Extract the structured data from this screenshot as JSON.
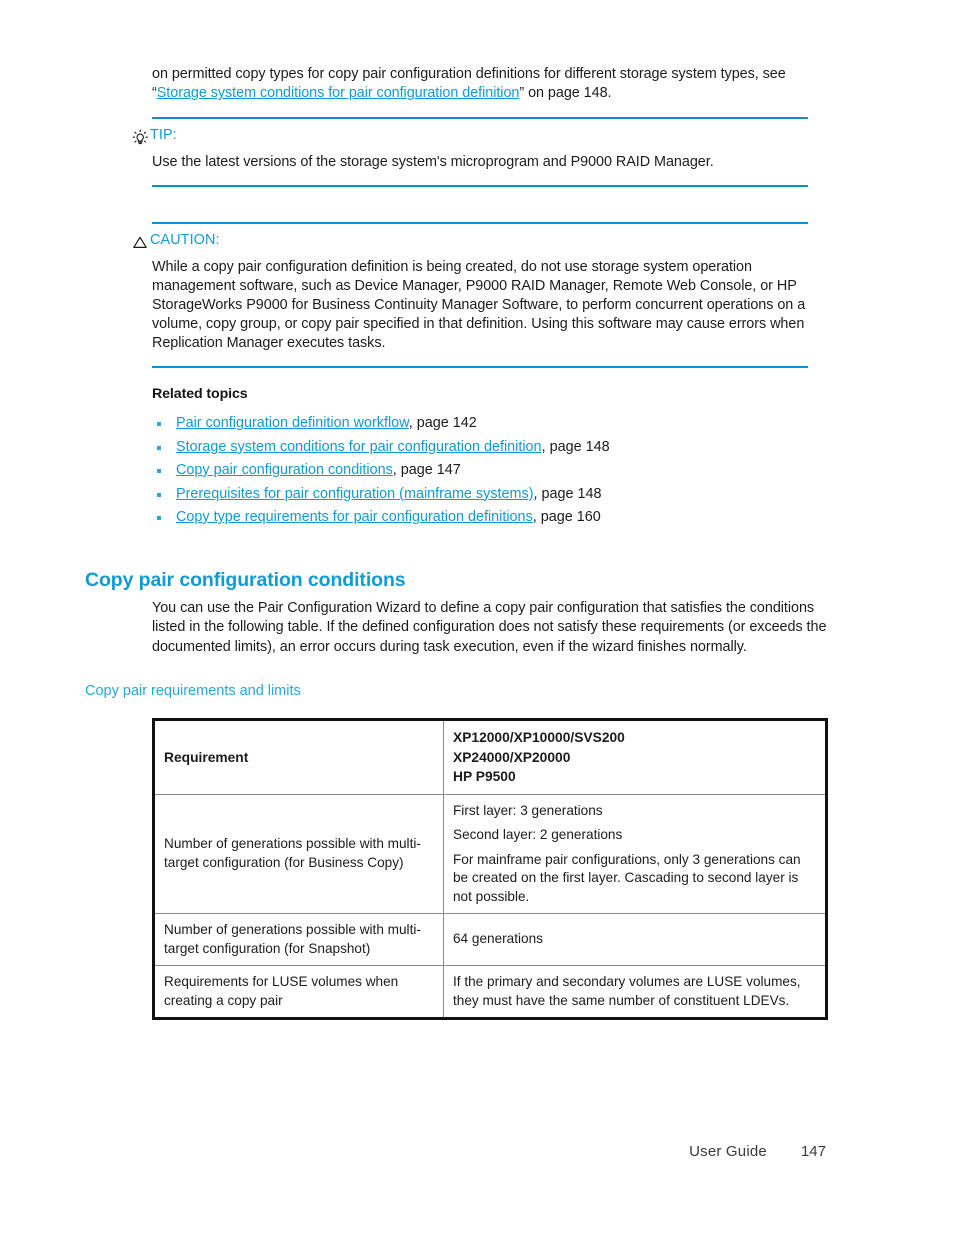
{
  "colors": {
    "link": "#0e9bd8",
    "heading": "#0e9bd8",
    "rule": "#0e8fce",
    "text": "#1c1c1c",
    "table_border": "#111111",
    "table_inner_border": "#8a8a8a"
  },
  "intro": {
    "text_before_link": "on permitted copy types for copy pair configuration definitions for different storage system types, see “",
    "link_text": "Storage system conditions for pair configuration definition",
    "text_after_link": "” on page 148."
  },
  "tip": {
    "icon": "lightbulb-icon",
    "label": "TIP:",
    "body": "Use the latest versions of the storage system's microprogram and P9000 RAID Manager."
  },
  "caution": {
    "icon": "warning-triangle-icon",
    "label": "CAUTION:",
    "body": "While a copy pair configuration definition is being created, do not use storage system operation management software, such as Device Manager, P9000 RAID Manager, Remote Web Console, or HP StorageWorks P9000 for Business Continuity Manager Software, to perform concurrent operations on a volume, copy group, or copy pair specified in that definition. Using this software may cause errors when Replication Manager executes tasks."
  },
  "related_topics": {
    "title": "Related topics",
    "items": [
      {
        "link": "Pair configuration definition workflow",
        "page": ", page 142"
      },
      {
        "link": "Storage system conditions for pair configuration definition",
        "page": ", page 148"
      },
      {
        "link": "Copy pair configuration conditions",
        "page": ", page 147"
      },
      {
        "link": "Prerequisites for pair configuration (mainframe systems)",
        "page": ", page 148"
      },
      {
        "link": "Copy type requirements for pair configuration definitions",
        "page": ", page 160"
      }
    ]
  },
  "section": {
    "heading": "Copy pair configuration conditions",
    "paragraph": "You can use the Pair Configuration Wizard to define a copy pair configuration that satisfies the conditions listed in the following table. If the defined configuration does not satisfy these requirements (or exceeds the documented limits), an error occurs during task execution, even if the wizard finishes normally."
  },
  "table": {
    "caption": "Copy pair requirements and limits",
    "headers": {
      "col1": "Requirement",
      "col2_line1": "XP12000/XP10000/SVS200",
      "col2_line2": "XP24000/XP20000",
      "col2_line3": "HP P9500"
    },
    "rows": [
      {
        "requirement": "Number of generations possible with multi-target configuration (for Business Copy)",
        "value_line1": "First layer: 3 generations",
        "value_line2": "Second layer: 2 generations",
        "value_line3": "For mainframe pair configurations, only 3 generations can be created on the first layer. Cascading to second layer is not possible."
      },
      {
        "requirement": "Number of generations possible with multi-target configuration (for Snapshot)",
        "value_line1": "64 generations"
      },
      {
        "requirement": "Requirements for LUSE volumes when creating a copy pair",
        "value_line1": "If the primary and secondary volumes are LUSE volumes, they must have the same number of constituent LDEVs."
      }
    ]
  },
  "footer": {
    "label": "User Guide",
    "page_number": "147"
  }
}
